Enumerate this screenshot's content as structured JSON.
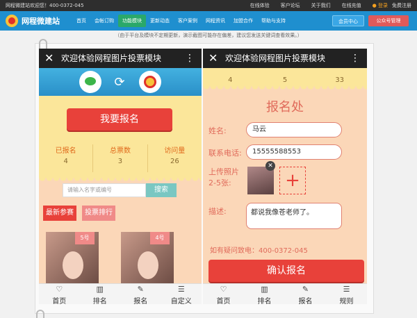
{
  "topbar": {
    "welcome": "网程微建站欢迎您！400-0372-045",
    "links": [
      "在线体验",
      "客户论坛",
      "关于我们",
      "在线充值"
    ],
    "login": "登录",
    "register": "免费注册"
  },
  "nav": {
    "logo": "网程微建站",
    "items": [
      "首页",
      "会帐订购",
      "功能模块",
      "更新动态",
      "客户案例",
      "网程资讯",
      "加盟合作",
      "帮助与支持"
    ],
    "active_index": 2,
    "member_btn": "会员中心",
    "public_btn": "公众号管理"
  },
  "notice": "（由于平台及模块不定期更新，演示截图可能存在偏差，建议您发送关键词查看效果。）",
  "phone1": {
    "title": "欢迎体验网程图片投票模块",
    "register_btn": "我要报名",
    "stats": [
      {
        "label": "已报名",
        "value": "4"
      },
      {
        "label": "总票数",
        "value": "3"
      },
      {
        "label": "访问量",
        "value": "26"
      }
    ],
    "search_placeholder": "请输入名字或编号",
    "search_btn": "搜索",
    "tag_new": "最新参赛",
    "tag_rank": "投票排行",
    "cards": [
      "5号",
      "4号"
    ],
    "tabs": [
      {
        "icon": "♡",
        "label": "首页"
      },
      {
        "icon": "▥",
        "label": "排名"
      },
      {
        "icon": "✎",
        "label": "报名"
      },
      {
        "icon": "☰",
        "label": "自定义"
      }
    ]
  },
  "phone2": {
    "title": "欢迎体验网程图片投票模块",
    "top_values": [
      "4",
      "5",
      "33"
    ],
    "heading": "报名处",
    "name_label": "姓名:",
    "name_value": "马云",
    "phone_label": "联系电话:",
    "phone_value": "15555588553",
    "photo_label": "上传照片 2-5张:",
    "desc_label": "描述:",
    "desc_value": "都说我像苍老师了。",
    "contact": "如有疑问致电：400-0372-045",
    "confirm_btn": "确认报名",
    "tabs": [
      {
        "icon": "♡",
        "label": "首页"
      },
      {
        "icon": "▥",
        "label": "排名"
      },
      {
        "icon": "✎",
        "label": "报名"
      },
      {
        "icon": "☰",
        "label": "规则"
      }
    ]
  }
}
